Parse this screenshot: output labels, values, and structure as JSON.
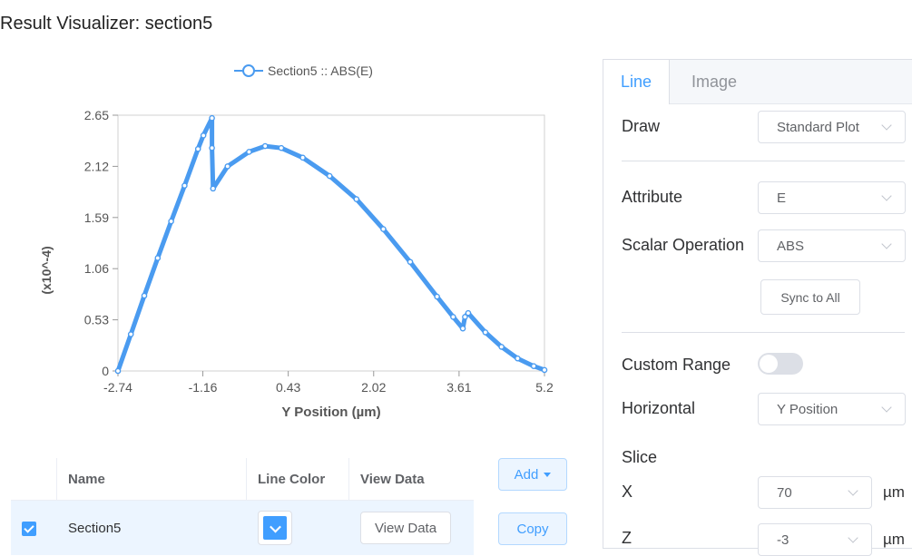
{
  "page": {
    "title": "Result Visualizer: section5"
  },
  "colors": {
    "accent": "#409eff",
    "series": "#4a9bf0"
  },
  "chart_data": {
    "type": "line",
    "series": [
      {
        "name": "Section5 :: ABS(E)",
        "points": [
          [
            -2.74,
            0
          ],
          [
            -2.5,
            0.38
          ],
          [
            -2.25,
            0.78
          ],
          [
            -2.0,
            1.17
          ],
          [
            -1.75,
            1.55
          ],
          [
            -1.5,
            1.92
          ],
          [
            -1.25,
            2.3
          ],
          [
            -1.15,
            2.44
          ],
          [
            -0.99,
            2.62
          ],
          [
            -0.99,
            2.31
          ],
          [
            -0.97,
            1.89
          ],
          [
            -0.7,
            2.12
          ],
          [
            -0.3,
            2.27
          ],
          [
            0.0,
            2.33
          ],
          [
            0.3,
            2.31
          ],
          [
            0.7,
            2.21
          ],
          [
            1.2,
            2.02
          ],
          [
            1.7,
            1.78
          ],
          [
            2.2,
            1.47
          ],
          [
            2.7,
            1.13
          ],
          [
            3.2,
            0.77
          ],
          [
            3.5,
            0.56
          ],
          [
            3.68,
            0.44
          ],
          [
            3.72,
            0.56
          ],
          [
            3.78,
            0.6
          ],
          [
            4.1,
            0.4
          ],
          [
            4.4,
            0.25
          ],
          [
            4.7,
            0.13
          ],
          [
            5.0,
            0.05
          ],
          [
            5.2,
            0.01
          ]
        ]
      }
    ],
    "xlabel": "Y Position (µm)",
    "ylabel": "(x10^-4)",
    "xticks": [
      "-2.74",
      "-1.16",
      "0.43",
      "2.02",
      "3.61",
      "5.2"
    ],
    "yticks": [
      "0",
      "0.53",
      "1.06",
      "1.59",
      "2.12",
      "2.65"
    ],
    "xlim": [
      -2.74,
      5.2
    ],
    "ylim": [
      0,
      2.65
    ],
    "legend": "top-center",
    "grid": false
  },
  "table": {
    "headers": {
      "name": "Name",
      "line_color": "Line Color",
      "view_data": "View Data"
    },
    "rows": [
      {
        "name": "Section5",
        "checked": true,
        "color": "#409eff",
        "view_button": "View Data"
      }
    ]
  },
  "actions": {
    "add_label": "Add",
    "copy_label": "Copy"
  },
  "panel": {
    "tabs": [
      {
        "label": "Line"
      },
      {
        "label": "Image"
      }
    ],
    "draw": {
      "label": "Draw",
      "value": "Standard Plot"
    },
    "attribute": {
      "label": "Attribute",
      "value": "E"
    },
    "scalar_operation": {
      "label": "Scalar Operation",
      "value": "ABS"
    },
    "sync_label": "Sync to All",
    "custom_range": {
      "label": "Custom Range",
      "enabled": false
    },
    "horizontal": {
      "label": "Horizontal",
      "value": "Y Position"
    },
    "slice": {
      "label": "Slice",
      "x": {
        "label": "X",
        "value": "70",
        "unit": "µm"
      },
      "z": {
        "label": "Z",
        "value": "-3",
        "unit": "µm"
      }
    }
  }
}
